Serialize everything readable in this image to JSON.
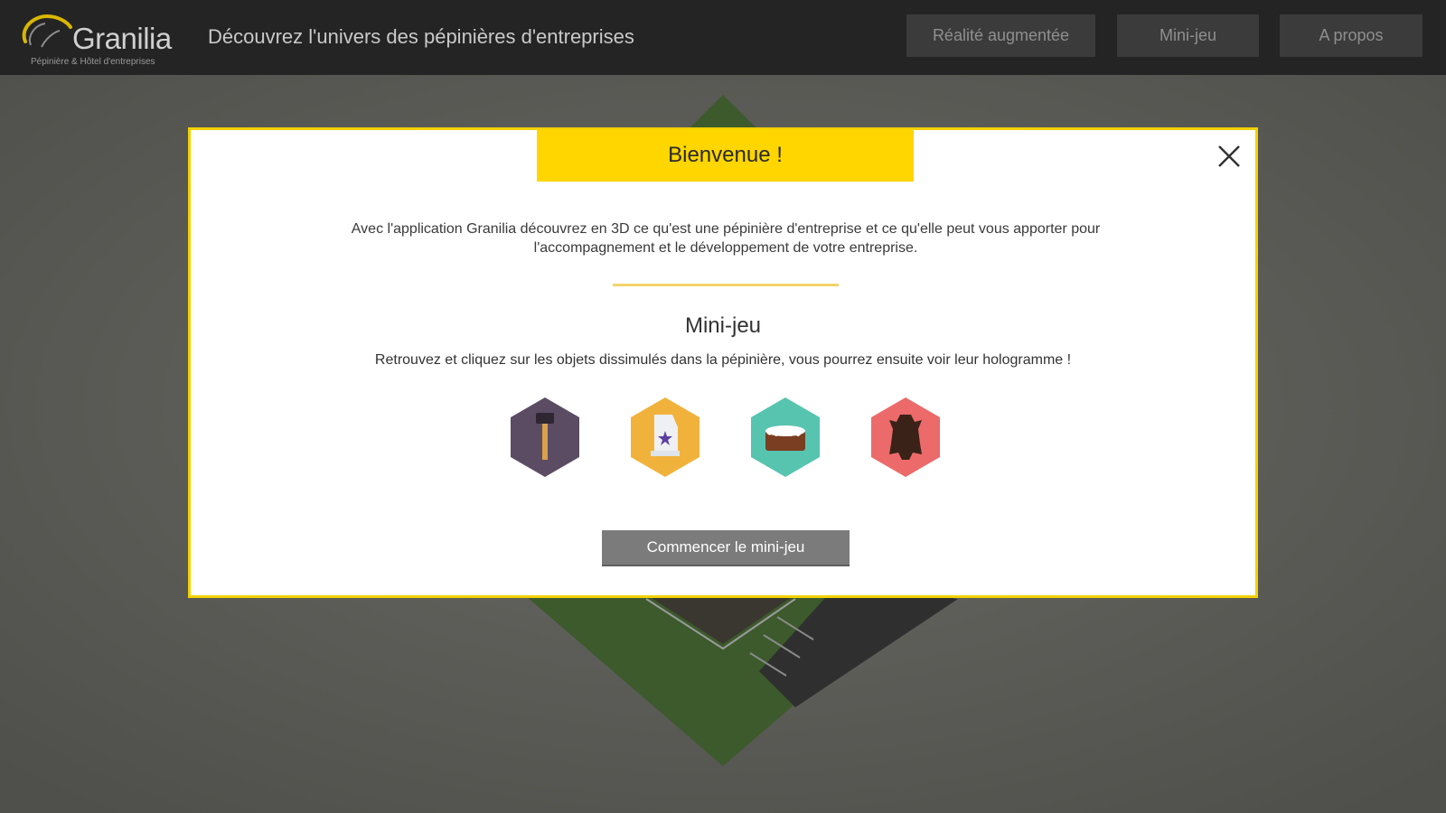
{
  "header": {
    "logo_name": "Granilia",
    "logo_tagline": "Pépinière & Hôtel d'entreprises",
    "headline": "Découvrez l'univers des pépinières d'entreprises",
    "nav": {
      "ar": "Réalité augmentée",
      "mini_game": "Mini-jeu",
      "about": "A propos"
    }
  },
  "modal": {
    "title": "Bienvenue !",
    "intro": "Avec l'application Granilia découvrez en 3D ce qu'est une pépinière d'entreprise et ce qu'elle peut vous apporter pour l'accompagnement et le développement de votre entreprise.",
    "section_title": "Mini-jeu",
    "section_desc": "Retrouvez et cliquez sur les objets dissimulés dans la pépinière, vous pourrez ensuite voir leur hologramme !",
    "start_button": "Commencer le mini-jeu",
    "items": [
      {
        "icon": "hammer-icon",
        "color": "#5b4b63"
      },
      {
        "icon": "trophy-icon",
        "color": "#f1b23c"
      },
      {
        "icon": "cake-icon",
        "color": "#57c4b0"
      },
      {
        "icon": "leather-hide-icon",
        "color": "#ec6a6a"
      }
    ]
  },
  "colors": {
    "accent": "#ffd600",
    "topbar": "#242424",
    "button": "#7b7b7b"
  }
}
